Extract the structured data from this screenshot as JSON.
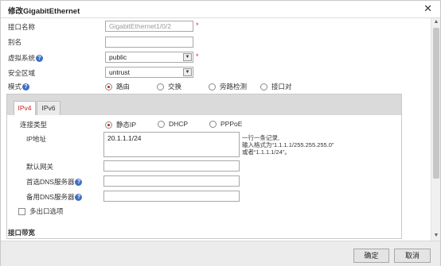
{
  "dialog": {
    "title": "修改GigabitEthernet"
  },
  "form": {
    "interface_name": {
      "label": "接口名称",
      "value": "GigabitEthernet1/0/2",
      "required": "*"
    },
    "alias": {
      "label": "别名",
      "value": ""
    },
    "vsys": {
      "label": "虚拟系统",
      "value": "public",
      "required": "*"
    },
    "zone": {
      "label": "安全区域",
      "value": "untrust"
    },
    "mode": {
      "label": "模式",
      "options": [
        "路由",
        "交换",
        "旁路检测",
        "接口对"
      ],
      "selected": "路由"
    }
  },
  "panel": {
    "tabs": [
      "IPv4",
      "IPv6"
    ],
    "active_tab": "IPv4",
    "conn_type": {
      "label": "连接类型",
      "options": [
        "静态IP",
        "DHCP",
        "PPPoE"
      ],
      "selected": "静态IP"
    },
    "ip": {
      "label": "IP地址",
      "value": "20.1.1.1/24"
    },
    "hint": [
      "一行一条记录,",
      "输入格式为“1.1.1.1/255.255.255.0”",
      "或者“1.1.1.1/24”。"
    ],
    "gateway": {
      "label": "默认网关",
      "value": ""
    },
    "dns1": {
      "label": "首选DNS服务器",
      "value": ""
    },
    "dns2": {
      "label": "备用DNS服务器",
      "value": ""
    },
    "multi_egress": {
      "label": "多出口选项",
      "checked": false
    }
  },
  "section": {
    "bandwidth": "接口带宽"
  },
  "buttons": {
    "ok": "确定",
    "cancel": "取消"
  },
  "help_icon": "?",
  "close_icon": "✕"
}
